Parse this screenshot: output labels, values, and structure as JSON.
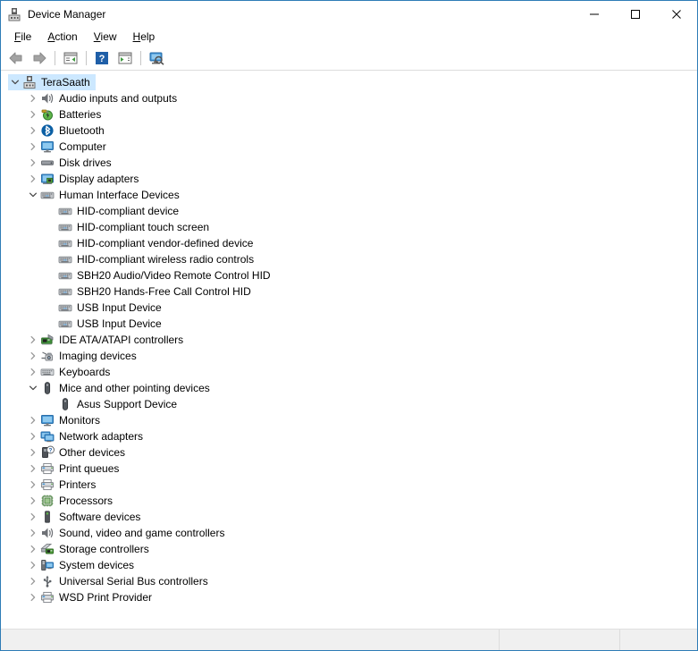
{
  "window": {
    "title": "Device Manager",
    "icon": "device-manager-icon",
    "border_color": "#2e7cb6",
    "caption_buttons": [
      {
        "name": "minimize-button",
        "label": "—",
        "icon": "minimize-icon"
      },
      {
        "name": "maximize-button",
        "label": "☐",
        "icon": "maximize-icon"
      },
      {
        "name": "close-button",
        "label": "✕",
        "icon": "close-icon"
      }
    ]
  },
  "menubar": {
    "items": [
      {
        "label": "File",
        "accel": "F"
      },
      {
        "label": "Action",
        "accel": "A"
      },
      {
        "label": "View",
        "accel": "V"
      },
      {
        "label": "Help",
        "accel": "H"
      }
    ]
  },
  "toolbar": {
    "buttons": [
      {
        "name": "back-button",
        "icon": "arrow-left-icon",
        "tooltip": "Back"
      },
      {
        "name": "forward-button",
        "icon": "arrow-right-icon",
        "tooltip": "Forward"
      },
      {
        "name": "separator-1",
        "icon": "separator"
      },
      {
        "name": "show-hide-console-tree-button",
        "icon": "console-tree-icon",
        "tooltip": "Show/Hide Console Tree"
      },
      {
        "name": "separator-2",
        "icon": "separator"
      },
      {
        "name": "help-button",
        "icon": "help-question-icon",
        "tooltip": "Help"
      },
      {
        "name": "properties-button",
        "icon": "properties-icon",
        "tooltip": "Properties"
      },
      {
        "name": "separator-3",
        "icon": "separator"
      },
      {
        "name": "scan-for-hardware-changes-button",
        "icon": "scan-hardware-icon",
        "tooltip": "Scan for hardware changes"
      }
    ]
  },
  "tree": {
    "selection": "TeraSaath",
    "selection_color": "#cce8ff",
    "nodes": [
      {
        "label": "TeraSaath",
        "depth": 0,
        "icon": "computer-root-icon",
        "state": "expanded",
        "selected": true
      },
      {
        "label": "Audio inputs and outputs",
        "depth": 1,
        "icon": "speaker-icon",
        "state": "collapsed",
        "selected": false
      },
      {
        "label": "Batteries",
        "depth": 1,
        "icon": "battery-icon",
        "state": "collapsed",
        "selected": false
      },
      {
        "label": "Bluetooth",
        "depth": 1,
        "icon": "bluetooth-icon",
        "state": "collapsed",
        "selected": false
      },
      {
        "label": "Computer",
        "depth": 1,
        "icon": "monitor-icon",
        "state": "collapsed",
        "selected": false
      },
      {
        "label": "Disk drives",
        "depth": 1,
        "icon": "disk-drive-icon",
        "state": "collapsed",
        "selected": false
      },
      {
        "label": "Display adapters",
        "depth": 1,
        "icon": "display-adapter-icon",
        "state": "collapsed",
        "selected": false
      },
      {
        "label": "Human Interface Devices",
        "depth": 1,
        "icon": "hid-icon",
        "state": "expanded",
        "selected": false
      },
      {
        "label": "HID-compliant device",
        "depth": 2,
        "icon": "hid-icon",
        "state": "leaf",
        "selected": false
      },
      {
        "label": "HID-compliant touch screen",
        "depth": 2,
        "icon": "hid-icon",
        "state": "leaf",
        "selected": false
      },
      {
        "label": "HID-compliant vendor-defined device",
        "depth": 2,
        "icon": "hid-icon",
        "state": "leaf",
        "selected": false
      },
      {
        "label": "HID-compliant wireless radio controls",
        "depth": 2,
        "icon": "hid-icon",
        "state": "leaf",
        "selected": false
      },
      {
        "label": "SBH20 Audio/Video Remote Control HID",
        "depth": 2,
        "icon": "hid-icon",
        "state": "leaf",
        "selected": false
      },
      {
        "label": "SBH20 Hands-Free Call Control HID",
        "depth": 2,
        "icon": "hid-icon",
        "state": "leaf",
        "selected": false
      },
      {
        "label": "USB Input Device",
        "depth": 2,
        "icon": "hid-icon",
        "state": "leaf",
        "selected": false
      },
      {
        "label": "USB Input Device",
        "depth": 2,
        "icon": "hid-icon",
        "state": "leaf",
        "selected": false
      },
      {
        "label": "IDE ATA/ATAPI controllers",
        "depth": 1,
        "icon": "ide-controller-icon",
        "state": "collapsed",
        "selected": false
      },
      {
        "label": "Imaging devices",
        "depth": 1,
        "icon": "camera-icon",
        "state": "collapsed",
        "selected": false
      },
      {
        "label": "Keyboards",
        "depth": 1,
        "icon": "keyboard-icon",
        "state": "collapsed",
        "selected": false
      },
      {
        "label": "Mice and other pointing devices",
        "depth": 1,
        "icon": "mouse-icon",
        "state": "expanded",
        "selected": false
      },
      {
        "label": "Asus Support Device",
        "depth": 2,
        "icon": "mouse-icon",
        "state": "leaf",
        "selected": false
      },
      {
        "label": "Monitors",
        "depth": 1,
        "icon": "monitor-icon",
        "state": "collapsed",
        "selected": false
      },
      {
        "label": "Network adapters",
        "depth": 1,
        "icon": "network-adapter-icon",
        "state": "collapsed",
        "selected": false
      },
      {
        "label": "Other devices",
        "depth": 1,
        "icon": "other-device-icon",
        "state": "collapsed",
        "selected": false
      },
      {
        "label": "Print queues",
        "depth": 1,
        "icon": "printer-icon",
        "state": "collapsed",
        "selected": false
      },
      {
        "label": "Printers",
        "depth": 1,
        "icon": "printer-icon",
        "state": "collapsed",
        "selected": false
      },
      {
        "label": "Processors",
        "depth": 1,
        "icon": "processor-icon",
        "state": "collapsed",
        "selected": false
      },
      {
        "label": "Software devices",
        "depth": 1,
        "icon": "software-device-icon",
        "state": "collapsed",
        "selected": false
      },
      {
        "label": "Sound, video and game controllers",
        "depth": 1,
        "icon": "speaker-icon",
        "state": "collapsed",
        "selected": false
      },
      {
        "label": "Storage controllers",
        "depth": 1,
        "icon": "storage-controller-icon",
        "state": "collapsed",
        "selected": false
      },
      {
        "label": "System devices",
        "depth": 1,
        "icon": "system-device-icon",
        "state": "collapsed",
        "selected": false
      },
      {
        "label": "Universal Serial Bus controllers",
        "depth": 1,
        "icon": "usb-icon",
        "state": "collapsed",
        "selected": false
      },
      {
        "label": "WSD Print Provider",
        "depth": 1,
        "icon": "printer-icon",
        "state": "collapsed",
        "selected": false
      }
    ]
  },
  "statusbar": {
    "panes": [
      "",
      "",
      ""
    ]
  }
}
